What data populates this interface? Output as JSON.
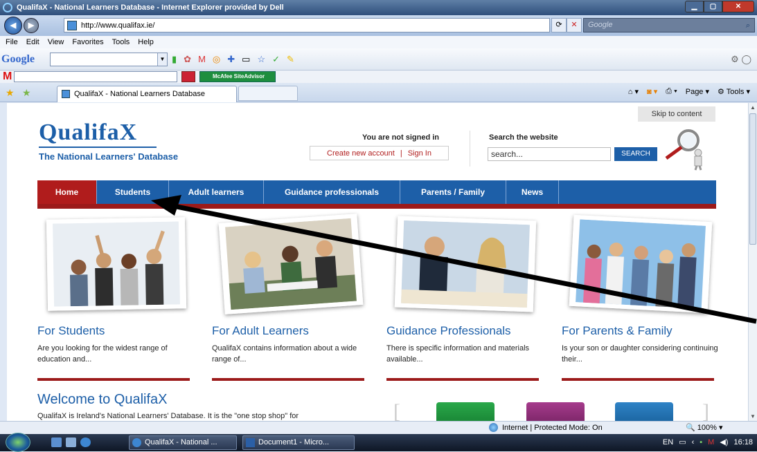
{
  "window": {
    "title": "QualifaX - National Learners Database - Internet Explorer provided by Dell",
    "url": "http://www.qualifax.ie/",
    "search_placeholder": "Google"
  },
  "menu": [
    "File",
    "Edit",
    "View",
    "Favorites",
    "Tools",
    "Help"
  ],
  "google_toolbar": {
    "logo": "Google"
  },
  "mcafee": {
    "label": "McAfee SiteAdvisor"
  },
  "browser_tab": {
    "title": "QualifaX - National Learners Database"
  },
  "commandbar": {
    "page": "Page",
    "tools": "Tools"
  },
  "site": {
    "skip": "Skip to content",
    "logo": "QualifaX",
    "tagline": "The National Learners' Database",
    "signin_status": "You are not signed in",
    "create_account": "Create new account",
    "signin": "Sign In",
    "search_title": "Search the website",
    "search_placeholder": "search...",
    "search_button": "SEARCH",
    "nav": [
      "Home",
      "Students",
      "Adult learners",
      "Guidance professionals",
      "Parents / Family",
      "News"
    ],
    "cards": [
      {
        "title": "For Students",
        "text": "Are you looking for the widest range of education and..."
      },
      {
        "title": "For Adult Learners",
        "text": "QualifaX contains information about a wide range of..."
      },
      {
        "title": "Guidance Professionals",
        "text": "There is specific information and materials available..."
      },
      {
        "title": "For Parents & Family",
        "text": "Is your son or daughter considering continuing their..."
      }
    ],
    "welcome_title": "Welcome to QualifaX",
    "welcome_text": "QualifaX is Ireland's National Learners' Database. It is the \"one stop shop\" for"
  },
  "status": {
    "zone": "Internet | Protected Mode: On",
    "zoom": "100%"
  },
  "taskbar": {
    "tasks": [
      "QualifaX - National ...",
      "Document1 - Micro..."
    ],
    "lang": "EN",
    "time": "16:18"
  }
}
